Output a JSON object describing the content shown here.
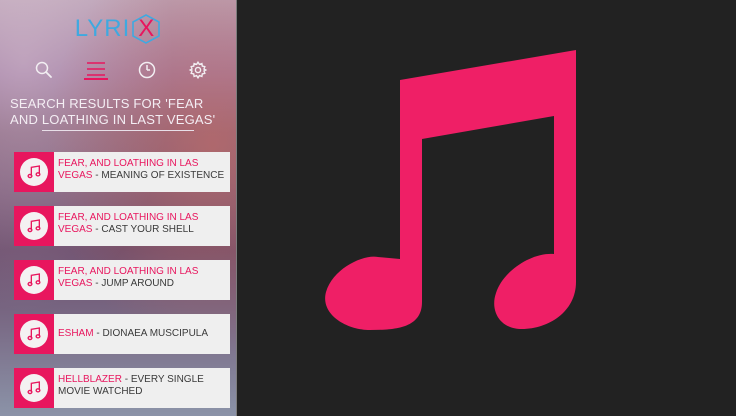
{
  "app": {
    "logo_prefix": "LYRI",
    "logo_x": "X"
  },
  "nav": {
    "items": [
      {
        "name": "search",
        "icon": "search-icon"
      },
      {
        "name": "menu",
        "icon": "hamburger-menu-icon",
        "active": true
      },
      {
        "name": "history",
        "icon": "clock-icon"
      },
      {
        "name": "settings",
        "icon": "gear-icon"
      }
    ]
  },
  "search": {
    "heading": "SEARCH RESULTS FOR 'FEAR AND LOATHING IN LAST VEGAS'"
  },
  "results": [
    {
      "artist": "FEAR, AND LOATHING IN LAS VEGAS",
      "separator": " - ",
      "title": "MEANING OF EXISTENCE"
    },
    {
      "artist": "FEAR, AND LOATHING IN LAS VEGAS",
      "separator": " - ",
      "title": "CAST YOUR SHELL"
    },
    {
      "artist": "FEAR, AND LOATHING IN LAS VEGAS",
      "separator": " - ",
      "title": "JUMP AROUND"
    },
    {
      "artist": "ESHAM",
      "separator": " - ",
      "title": "DIONAEA MUSCIPULA"
    },
    {
      "artist": "HELLBLAZER",
      "separator": " - ",
      "title": "EVERY SINGLE MOVIE WATCHED"
    }
  ],
  "colors": {
    "accent": "#e8165e",
    "logo_blue": "#3fa9e0",
    "background": "#222222",
    "card": "#efefef"
  },
  "decor": {
    "large_icon": "music-note-icon"
  }
}
